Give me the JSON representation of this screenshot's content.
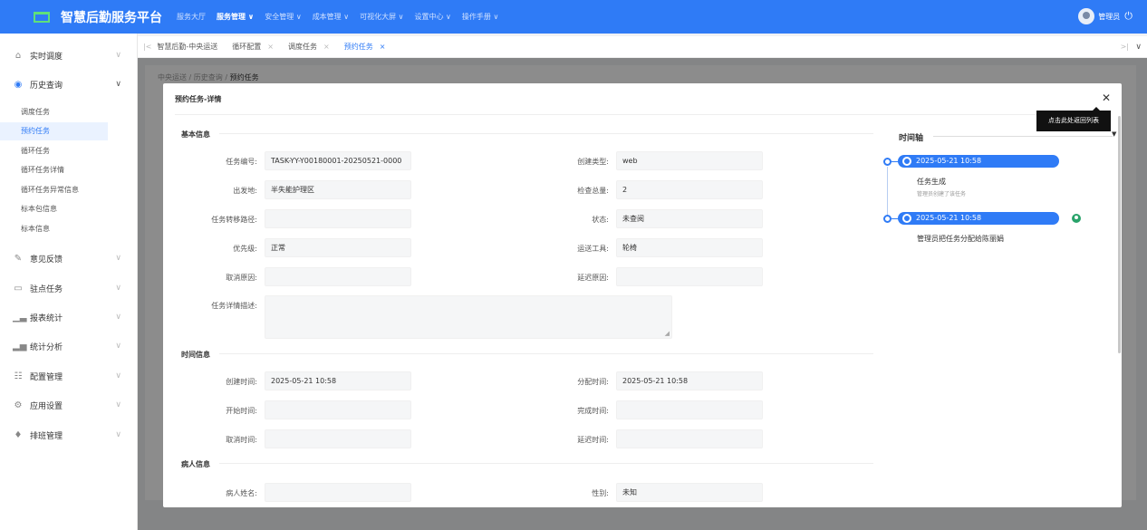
{
  "app": {
    "title": "智慧后勤服务平台"
  },
  "topnav": {
    "items": [
      "服务大厅",
      "服务管理 ∨",
      "安全管理 ∨",
      "成本管理 ∨",
      "可视化大屏 ∨",
      "设置中心 ∨",
      "操作手册 ∨"
    ]
  },
  "user": {
    "name": "管理员"
  },
  "sidebar": {
    "groups": [
      "实时调度",
      "历史查询",
      "意见反馈",
      "驻点任务",
      "报表统计",
      "统计分析",
      "配置管理",
      "应用设置",
      "排班管理"
    ],
    "history_items": [
      "调度任务",
      "预约任务",
      "循环任务",
      "循环任务详情",
      "循环任务异常信息",
      "标本包信息",
      "标本信息"
    ]
  },
  "tabs": [
    {
      "label": "智慧后勤-中央运送"
    },
    {
      "label": "循环配置"
    },
    {
      "label": "调度任务"
    },
    {
      "label": "预约任务"
    }
  ],
  "breadcrumb": {
    "part1": "中央运送",
    "part2": "历史查询",
    "current": "预约任务",
    "sep": "/"
  },
  "modal": {
    "title": "预约任务-详情",
    "tooltip": "点击此处返回列表",
    "sections": {
      "basic": "基本信息",
      "time": "时间信息",
      "patient": "病人信息"
    },
    "basic": {
      "task_no_label": "任务编号:",
      "task_no": "TASK-YY-Y00180001-20250521-0000",
      "create_type_label": "创建类型:",
      "create_type": "web",
      "origin_label": "出发地:",
      "origin": "半失能护理区",
      "check_total_label": "检查总量:",
      "check_total": "2",
      "route_label": "任务转移路径:",
      "route": "",
      "status_label": "状态:",
      "status": "未查阅",
      "priority_label": "优先级:",
      "priority": "正常",
      "tool_label": "运送工具:",
      "tool": "轮椅",
      "cancel_reason_label": "取消原因:",
      "cancel_reason": "",
      "delay_reason_label": "延迟原因:",
      "delay_reason": "",
      "desc_label": "任务详情描述:",
      "desc": ""
    },
    "time": {
      "created_label": "创建时间:",
      "created": "2025-05-21 10:58",
      "assigned_label": "分配时间:",
      "assigned": "2025-05-21 10:58",
      "start_label": "开始时间:",
      "start": "",
      "finish_label": "完成时间:",
      "finish": "",
      "cancel_label": "取消时间:",
      "cancel": "",
      "delay_label": "延迟时间:",
      "delay": ""
    },
    "patient": {
      "name_label": "病人姓名:",
      "name": "",
      "gender_label": "性别:",
      "gender": "未知"
    }
  },
  "timeline": {
    "title": "时间轴",
    "events": [
      {
        "time": "2025-05-21 10:58",
        "title": "任务生成",
        "sub": "管理员创建了该任务"
      },
      {
        "time": "2025-05-21 10:58",
        "title": "管理员把任务分配给陈丽娟",
        "sub": ""
      }
    ]
  },
  "colors": {
    "primary": "#2f7bf6",
    "success": "#29a36a",
    "logo": "#5fe07a"
  }
}
